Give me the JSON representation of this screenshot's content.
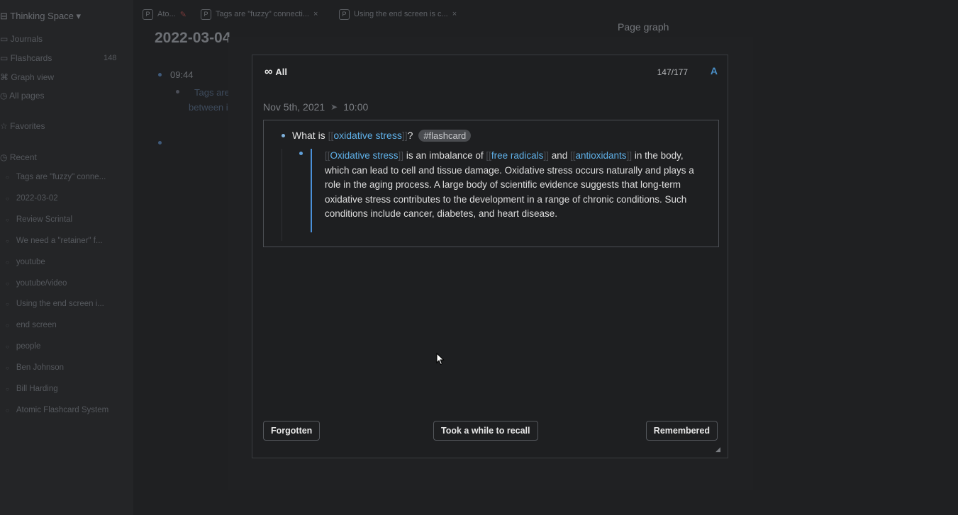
{
  "sidebar": {
    "workspace": "Thinking Space",
    "nav": [
      {
        "label": "Journals"
      },
      {
        "label": "Flashcards",
        "count": "148"
      },
      {
        "label": "Graph view"
      },
      {
        "label": "All pages"
      }
    ],
    "favorites_label": "Favorites",
    "recent_label": "Recent",
    "recent": [
      "Tags are \"fuzzy\" conne...",
      "2022-03-02",
      "Review Scrintal",
      "We need a \"retainer\" f...",
      "youtube",
      "youtube/video",
      "Using the end screen i...",
      "end screen",
      "people",
      "Ben Johnson",
      "Bill Harding",
      "Atomic Flashcard System"
    ]
  },
  "tabs": [
    {
      "label": "Ato..."
    },
    {
      "label": "Tags are \"fuzzy\" connecti..."
    },
    {
      "label": "Using the end screen is c..."
    }
  ],
  "main": {
    "date_title": "2022-03-04",
    "time": "09:44",
    "text_line1": "Tags are",
    "text_line2": "between i"
  },
  "right": {
    "page_graph": "Page graph"
  },
  "modal": {
    "deck": "All",
    "counter": "147/177",
    "a_icon": "A",
    "block_date": "Nov 5th, 2021",
    "block_time": "10:00",
    "question": {
      "prefix": "What is ",
      "link": "oxidative stress",
      "suffix": "?",
      "tag": "#flashcard"
    },
    "answer": {
      "link1": "Oxidative stress",
      "t1": " is an imbalance of ",
      "link2": "free radicals",
      "t2": " and ",
      "link3": "antioxidants",
      "t3": " in the body, which can lead to cell and tissue damage. Oxidative stress occurs naturally and plays a role in the aging process. A large body of scientific evidence suggests that long-term oxidative stress contributes to the development in a range of chronic conditions. Such conditions include cancer, diabetes, and heart disease."
    },
    "buttons": {
      "forgotten": "Forgotten",
      "recall": "Took a while to recall",
      "remembered": "Remembered"
    }
  },
  "colors": {
    "accent": "#4a90d9",
    "link": "#5fb0e8",
    "modal_bg": "#1e1f21"
  }
}
